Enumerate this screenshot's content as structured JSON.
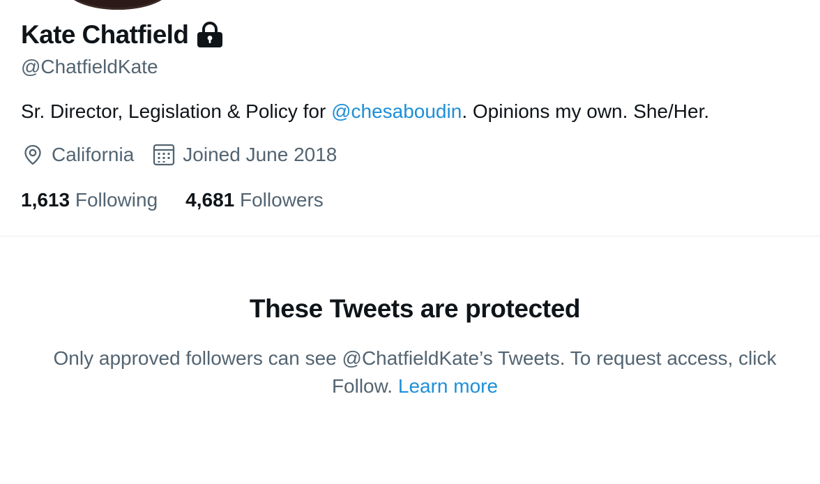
{
  "profile": {
    "name": "Kate Chatfield",
    "handle": "@ChatfieldKate",
    "protected_icon": "lock-icon",
    "bio": {
      "prefix": "Sr. Director, Legislation & Policy for ",
      "mention": "@chesaboudin",
      "suffix": ". Opinions my own. She/Her."
    },
    "location": {
      "icon": "location-pin-icon",
      "text": "California"
    },
    "joined": {
      "icon": "calendar-icon",
      "text": "Joined June 2018"
    },
    "following": {
      "count": "1,613",
      "label": "Following"
    },
    "followers": {
      "count": "4,681",
      "label": "Followers"
    }
  },
  "protected": {
    "title": "These Tweets are protected",
    "message": "Only approved followers can see @ChatfieldKate’s Tweets. To request access, click Follow.",
    "link": "Learn more"
  },
  "colors": {
    "text": "#0f1419",
    "secondary": "#536471",
    "link": "#1d8fd8",
    "divider": "#e6ecf0"
  }
}
